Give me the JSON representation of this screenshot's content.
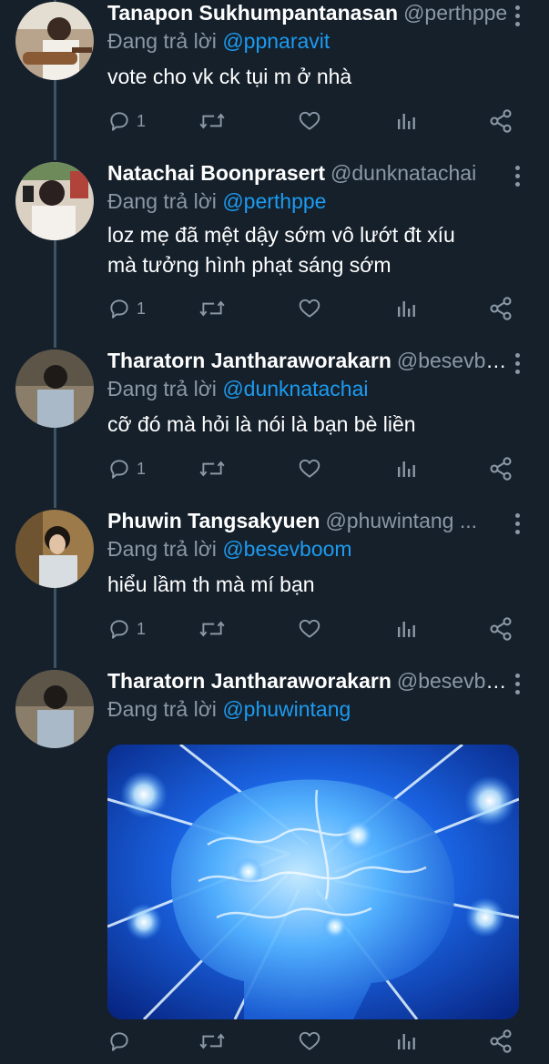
{
  "tweets": [
    {
      "name": "Tanapon Sukhumpantanasan",
      "handle": "@perthppe",
      "reply_prefix": "Đang trả lời",
      "reply_to": "@ppnaravit",
      "text": "vote cho vk ck tụi m ở nhà",
      "reply_count": "1"
    },
    {
      "name": "Natachai Boonprasert",
      "handle": "@dunknatachai",
      "reply_prefix": "Đang trả lời",
      "reply_to": "@perthppe",
      "text": "loz mẹ đã mệt dậy sớm vô lướt đt xíu\nmà tưởng hình phạt sáng sớm",
      "reply_count": "1"
    },
    {
      "name": "Tharatorn Jantharaworakarn",
      "handle": "@besevboom",
      "reply_prefix": "Đang trả lời",
      "reply_to": "@dunknatachai",
      "text": "cỡ đó mà hỏi là nói là bạn bè liền",
      "reply_count": "1"
    },
    {
      "name": "Phuwin Tangsakyuen",
      "handle": "@phuwintang ...",
      "reply_prefix": "Đang trả lời",
      "reply_to": "@besevboom",
      "text": "hiểu lầm th mà mí bạn",
      "reply_count": "1"
    },
    {
      "name": "Tharatorn Jantharaworakarn",
      "handle": "@besevboom",
      "reply_prefix": "Đang trả lời",
      "reply_to": "@phuwintang",
      "text": "",
      "reply_count": ""
    }
  ],
  "icons": {
    "reply": "reply-icon",
    "retweet": "retweet-icon",
    "like": "heart-icon",
    "analytics": "analytics-icon",
    "share": "share-icon",
    "more": "more-icon"
  },
  "colors": {
    "background": "#15202b",
    "mention": "#1d9bf0",
    "secondary_text": "#8b98a5"
  }
}
